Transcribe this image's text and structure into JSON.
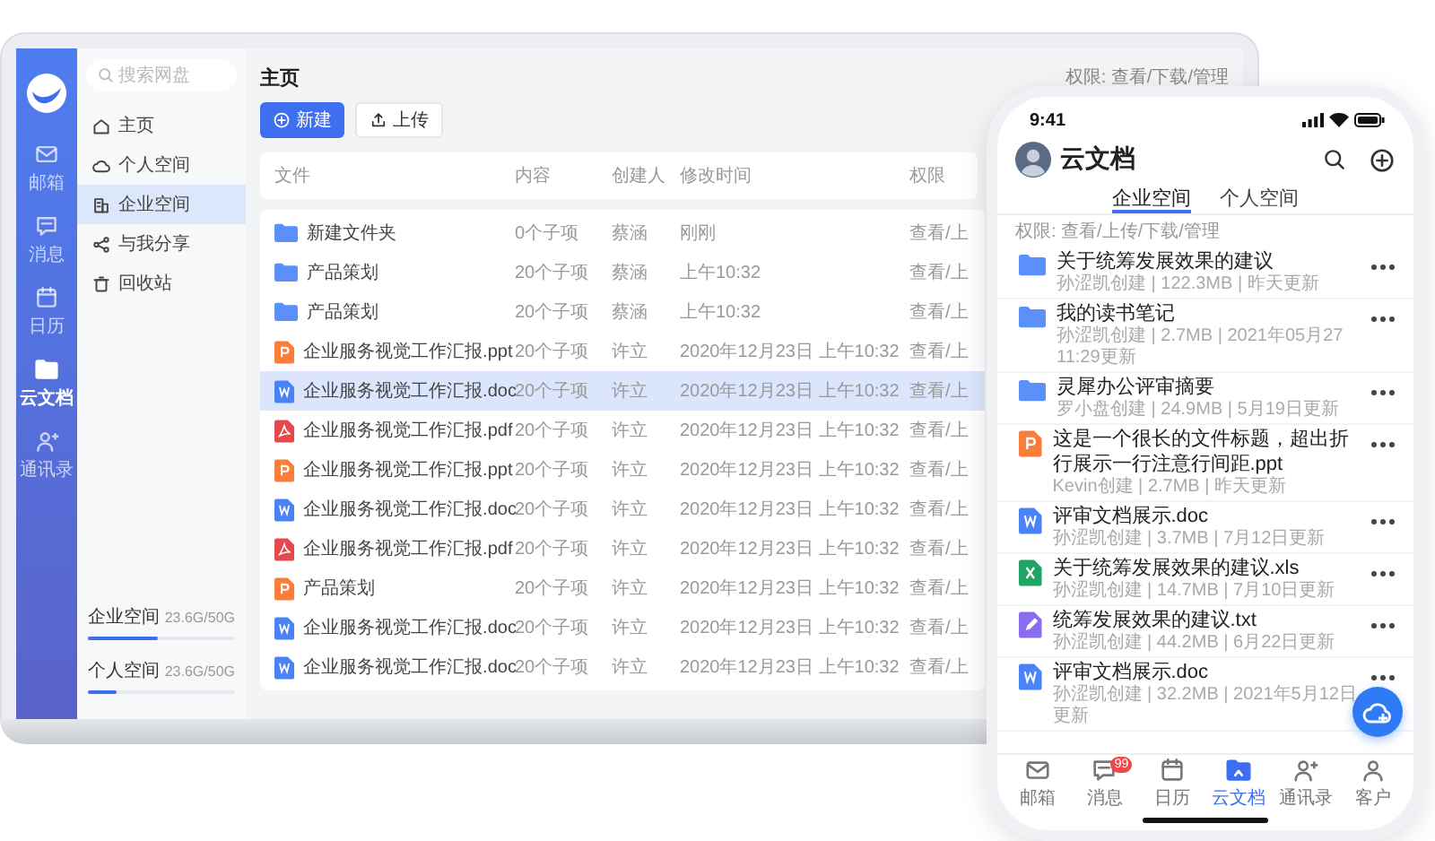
{
  "laptop": {
    "rail": {
      "items": [
        {
          "label": "邮箱",
          "selected": false
        },
        {
          "label": "消息",
          "selected": false
        },
        {
          "label": "日历",
          "selected": false
        },
        {
          "label": "云文档",
          "selected": true
        },
        {
          "label": "通讯录",
          "selected": false
        }
      ]
    },
    "nav": {
      "search": {
        "placeholder": "搜索网盘"
      },
      "items": [
        {
          "label": "主页",
          "selected": false
        },
        {
          "label": "个人空间",
          "selected": false
        },
        {
          "label": "企业空间",
          "selected": true
        },
        {
          "label": "与我分享",
          "selected": false
        },
        {
          "label": "回收站",
          "selected": false
        }
      ],
      "storage": [
        {
          "label": "企业空间",
          "reading": "23.6G/50G",
          "level": 0.47
        },
        {
          "label": "个人空间",
          "reading": "23.6G/50G",
          "level": 0.2
        }
      ]
    },
    "main": {
      "title": "主页",
      "permission_note": "权限: 查看/下载/管理",
      "buttons": [
        {
          "label": "新建",
          "kind": "primary"
        },
        {
          "label": "上传",
          "kind": "secondary"
        }
      ],
      "table": {
        "columns": [
          "文件",
          "内容",
          "创建人",
          "修改时间",
          "权限"
        ],
        "rows": [
          {
            "kind": "folder",
            "name": "新建文件夹",
            "content": "0个子项",
            "creator": "蔡涵",
            "modified": "刚刚",
            "permission": "查看/上",
            "selected": false
          },
          {
            "kind": "folder",
            "name": "产品策划",
            "content": "20个子项",
            "creator": "蔡涵",
            "modified": "上午10:32",
            "permission": "查看/上",
            "selected": false
          },
          {
            "kind": "folder",
            "name": "产品策划",
            "content": "20个子项",
            "creator": "蔡涵",
            "modified": "上午10:32",
            "permission": "查看/上",
            "selected": false
          },
          {
            "kind": "ppt",
            "name": "企业服务视觉工作汇报.ppt",
            "content": "20个子项",
            "creator": "许立",
            "modified": "2020年12月23日 上午10:32",
            "permission": "查看/上",
            "selected": false
          },
          {
            "kind": "doc",
            "name": "企业服务视觉工作汇报.doc",
            "content": "20个子项",
            "creator": "许立",
            "modified": "2020年12月23日 上午10:32",
            "permission": "查看/上",
            "selected": true
          },
          {
            "kind": "pdf",
            "name": "企业服务视觉工作汇报.pdf",
            "content": "20个子项",
            "creator": "许立",
            "modified": "2020年12月23日 上午10:32",
            "permission": "查看/上",
            "selected": false
          },
          {
            "kind": "ppt",
            "name": "企业服务视觉工作汇报.ppt",
            "content": "20个子项",
            "creator": "许立",
            "modified": "2020年12月23日 上午10:32",
            "permission": "查看/上",
            "selected": false
          },
          {
            "kind": "doc",
            "name": "企业服务视觉工作汇报.doc",
            "content": "20个子项",
            "creator": "许立",
            "modified": "2020年12月23日 上午10:32",
            "permission": "查看/上",
            "selected": false
          },
          {
            "kind": "pdf",
            "name": "企业服务视觉工作汇报.pdf",
            "content": "20个子项",
            "creator": "许立",
            "modified": "2020年12月23日 上午10:32",
            "permission": "查看/上",
            "selected": false
          },
          {
            "kind": "ppt",
            "name": "产品策划",
            "content": "20个子项",
            "creator": "许立",
            "modified": "2020年12月23日 上午10:32",
            "permission": "查看/上",
            "selected": false
          },
          {
            "kind": "doc",
            "name": "企业服务视觉工作汇报.doc",
            "content": "20个子项",
            "creator": "许立",
            "modified": "2020年12月23日 上午10:32",
            "permission": "查看/上",
            "selected": false
          },
          {
            "kind": "doc",
            "name": "企业服务视觉工作汇报.doc",
            "content": "20个子项",
            "creator": "许立",
            "modified": "2020年12月23日 上午10:32",
            "permission": "查看/上",
            "selected": false
          }
        ]
      }
    }
  },
  "phone": {
    "time": "9:41",
    "title": "云文档",
    "tabs": [
      {
        "label": "企业空间",
        "selected": true
      },
      {
        "label": "个人空间",
        "selected": false
      }
    ],
    "permission_note": "权限: 查看/上传/下载/管理",
    "files": [
      {
        "kind": "folder",
        "name": "关于统筹发展效果的建议",
        "meta": "孙涩凯创建 | 122.3MB | 昨天更新"
      },
      {
        "kind": "folder",
        "name": "我的读书笔记",
        "meta": "孙涩凯创建 | 2.7MB | 2021年05月27 11:29更新"
      },
      {
        "kind": "folder",
        "name": "灵犀办公评审摘要",
        "meta": "罗小盘创建 | 24.9MB | 5月19日更新"
      },
      {
        "kind": "ppt",
        "name": "这是一个很长的文件标题，超出折行展示一行注意行间距.ppt",
        "meta": "Kevin创建 | 2.7MB | 昨天更新"
      },
      {
        "kind": "doc",
        "name": "评审文档展示.doc",
        "meta": "孙涩凯创建 | 3.7MB | 7月12日更新"
      },
      {
        "kind": "xls",
        "name": "关于统筹发展效果的建议.xls",
        "meta": "孙涩凯创建 | 14.7MB | 7月10日更新"
      },
      {
        "kind": "txt",
        "name": "统筹发展效果的建议.txt",
        "meta": "孙涩凯创建 | 44.2MB | 6月22日更新"
      },
      {
        "kind": "doc",
        "name": "评审文档展示.doc",
        "meta": "孙涩凯创建 | 32.2MB | 2021年5月12日更新"
      }
    ],
    "tabbar": [
      {
        "label": "邮箱",
        "selected": false
      },
      {
        "label": "消息",
        "selected": false,
        "badge": "99"
      },
      {
        "label": "日历",
        "selected": false
      },
      {
        "label": "云文档",
        "selected": true
      },
      {
        "label": "通讯录",
        "selected": false
      },
      {
        "label": "客户",
        "selected": false
      }
    ]
  }
}
